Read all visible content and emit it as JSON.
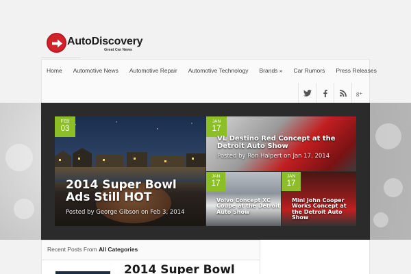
{
  "site": {
    "logo_name": "AutoDiscovery",
    "logo_tagline": "Great Car News",
    "brand_red": "#d2232a",
    "accent_green": "#8cbf26"
  },
  "nav": {
    "items": [
      {
        "label": "Home"
      },
      {
        "label": "Automotive News"
      },
      {
        "label": "Automotive Repair"
      },
      {
        "label": "Automotive Technology"
      },
      {
        "label": "Brands »"
      },
      {
        "label": "Car Rumors"
      },
      {
        "label": "Press Releases"
      }
    ],
    "social": [
      {
        "icon": "twitter-icon"
      },
      {
        "icon": "facebook-icon"
      },
      {
        "icon": "rss-icon"
      },
      {
        "icon": "google-plus-icon"
      }
    ]
  },
  "slider": {
    "main": {
      "month": "FEB",
      "day": "03",
      "title": "2014 Super Bowl Ads Still HOT",
      "meta": "Posted by George Gibson on Feb 3, 2014"
    },
    "top_right": {
      "month": "JAN",
      "day": "17",
      "title": "VL Destino Red Concept at the Detroit Auto Show",
      "meta": "Posted by Ron Halpert on Jan 17, 2014"
    },
    "bottom_left": {
      "month": "JAN",
      "day": "17",
      "title": "Volvo Concept XC Coupe at the Detroit Auto Show"
    },
    "bottom_right": {
      "month": "JAN",
      "day": "17",
      "title": "Mini John Cooper Works Concept at the Detroit Auto Show"
    }
  },
  "recent": {
    "prefix": "Recent Posts From",
    "category": "All Categories",
    "first_post_title": "2014 Super Bowl"
  }
}
